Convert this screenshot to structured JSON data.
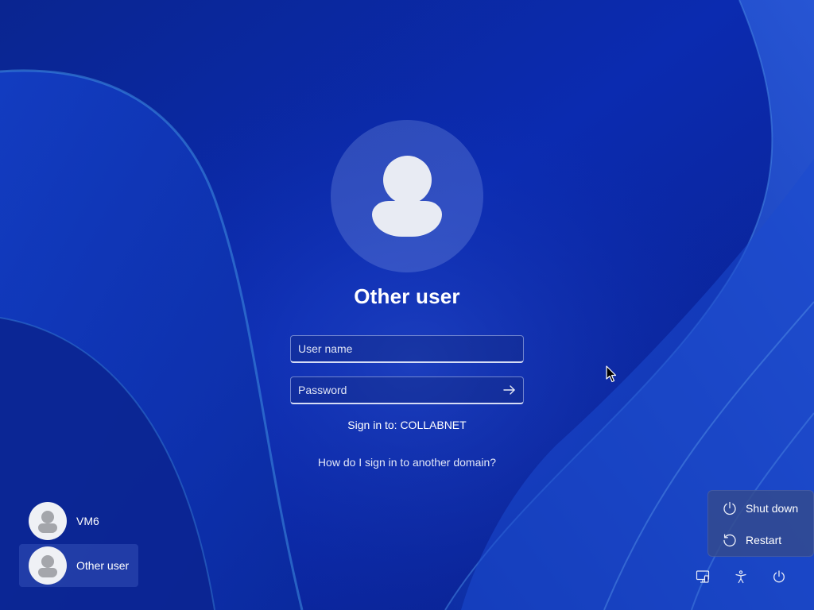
{
  "login": {
    "user_title": "Other user",
    "username_placeholder": "User name",
    "password_placeholder": "Password",
    "sign_in_to": "Sign in to: COLLABNET",
    "domain_help_link": "How do I sign in to another domain?"
  },
  "users": [
    {
      "name": "VM6",
      "selected": false,
      "avatar_icon": "user-avatar-icon"
    },
    {
      "name": "Other user",
      "selected": true,
      "avatar_icon": "user-avatar-icon"
    }
  ],
  "power_menu": {
    "items": [
      {
        "label": "Shut down",
        "icon": "power-icon"
      },
      {
        "label": "Restart",
        "icon": "restart-icon"
      }
    ]
  },
  "corner_controls": [
    {
      "icon": "network-icon"
    },
    {
      "icon": "accessibility-icon"
    },
    {
      "icon": "power-icon"
    }
  ],
  "colors": {
    "background": "#0a2aa8",
    "text": "#ffffff",
    "avatar_fill": "#e8ebf3"
  }
}
